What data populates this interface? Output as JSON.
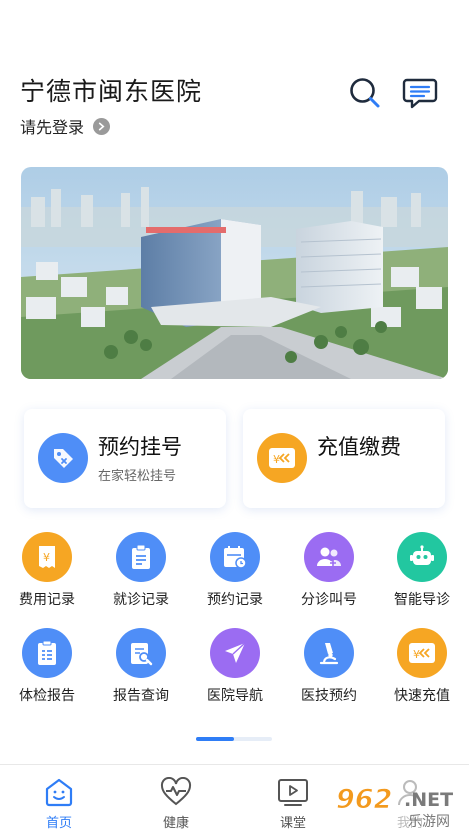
{
  "header": {
    "title": "宁德市闽东医院",
    "login_text": "请先登录"
  },
  "cards": [
    {
      "title": "预约挂号",
      "subtitle": "在家轻松挂号",
      "icon": "tag-icon",
      "color": "#4f8ef7"
    },
    {
      "title": "充值缴费",
      "subtitle": "",
      "icon": "yuan-card-icon",
      "color": "#f6a623"
    }
  ],
  "grid": [
    {
      "label": "费用记录",
      "icon": "receipt-icon",
      "color": "#f6a623"
    },
    {
      "label": "就诊记录",
      "icon": "clipboard-icon",
      "color": "#4f8ef7"
    },
    {
      "label": "预约记录",
      "icon": "calendar-icon",
      "color": "#4f8ef7"
    },
    {
      "label": "分诊叫号",
      "icon": "people-icon",
      "color": "#9b6cf2"
    },
    {
      "label": "智能导诊",
      "icon": "robot-icon",
      "color": "#22c7a0"
    },
    {
      "label": "体检报告",
      "icon": "report-icon",
      "color": "#4f8ef7"
    },
    {
      "label": "报告查询",
      "icon": "report-search-icon",
      "color": "#4f8ef7"
    },
    {
      "label": "医院导航",
      "icon": "navigation-icon",
      "color": "#9b6cf2"
    },
    {
      "label": "医技预约",
      "icon": "microscope-icon",
      "color": "#4f8ef7"
    },
    {
      "label": "快速充值",
      "icon": "yuan-card-icon",
      "color": "#f6a623"
    }
  ],
  "pager": {
    "pages": 2,
    "current": 1
  },
  "tabs": [
    {
      "label": "首页",
      "icon": "home-icon",
      "active": true
    },
    {
      "label": "健康",
      "icon": "heart-pulse-icon",
      "active": false
    },
    {
      "label": "课堂",
      "icon": "video-icon",
      "active": false
    },
    {
      "label": "我的",
      "icon": "user-icon",
      "active": false
    }
  ],
  "watermark": {
    "brand": "962.NET",
    "sub": "乐游网"
  },
  "colors": {
    "accent": "#2f7df6",
    "orange": "#f6a623",
    "purple": "#9b6cf2",
    "teal": "#22c7a0"
  }
}
